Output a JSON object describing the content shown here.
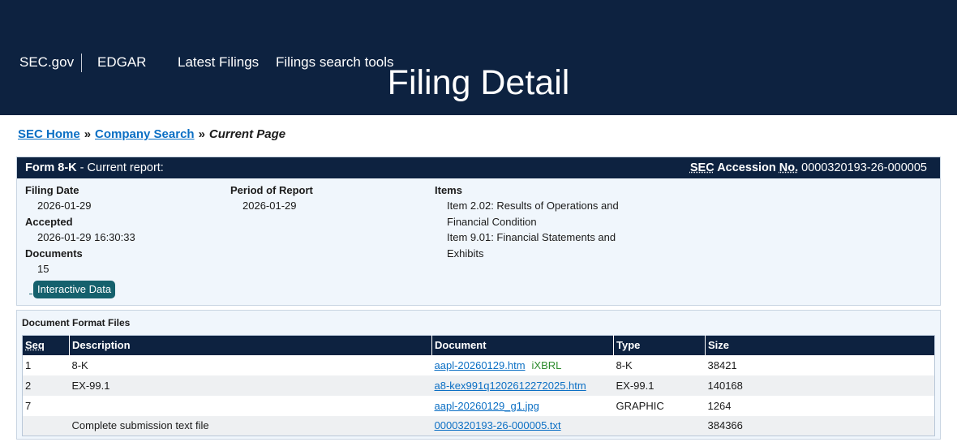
{
  "header": {
    "brand": "SEC.gov",
    "edgar": "EDGAR",
    "nav": [
      "Latest Filings",
      "Filings search tools"
    ],
    "title": "Filing Detail"
  },
  "breadcrumb": {
    "home": "SEC Home",
    "company": "Company Search",
    "current": "Current Page",
    "separator": "»"
  },
  "form": {
    "type": "Form 8-K",
    "description": " - Current report:",
    "accession_label_sec": "SEC",
    "accession_label_rest": " Accession ",
    "accession_label_no": "No.",
    "accession_number": "0000320193-26-000005"
  },
  "details": {
    "filing_date_label": "Filing Date",
    "filing_date": "2026-01-29",
    "accepted_label": "Accepted",
    "accepted": "2026-01-29 16:30:33",
    "documents_label": "Documents",
    "documents": "15",
    "period_label": "Period of Report",
    "period": "2026-01-29",
    "items_label": "Items",
    "items": [
      "Item 2.02: Results of Operations and Financial Condition",
      "Item 9.01: Financial Statements and Exhibits"
    ],
    "interactive_label": "Interactive Data"
  },
  "files": {
    "title": "Document Format Files",
    "columns": [
      "Seq",
      "Description",
      "Document",
      "Type",
      "Size"
    ],
    "rows": [
      {
        "seq": "1",
        "description": "8-K",
        "document": "aapl-20260129.htm",
        "tag": "iXBRL",
        "type": "8-K",
        "size": "38421"
      },
      {
        "seq": "2",
        "description": "EX-99.1",
        "document": "a8-kex991q1202612272025.htm",
        "tag": "",
        "type": "EX-99.1",
        "size": "140168"
      },
      {
        "seq": "7",
        "description": "",
        "document": "aapl-20260129_g1.jpg",
        "tag": "",
        "type": "GRAPHIC",
        "size": "1264"
      },
      {
        "seq": "",
        "description": "Complete submission text file",
        "document": "0000320193-26-000005.txt",
        "tag": "",
        "type": "",
        "size": "384366"
      }
    ]
  },
  "colors": {
    "header_bg": "#0d2240",
    "link": "#0b6fc4",
    "card_bg": "#f0f6fc",
    "interactive_btn": "#15616d",
    "xbrl": "#2e8b2e"
  }
}
